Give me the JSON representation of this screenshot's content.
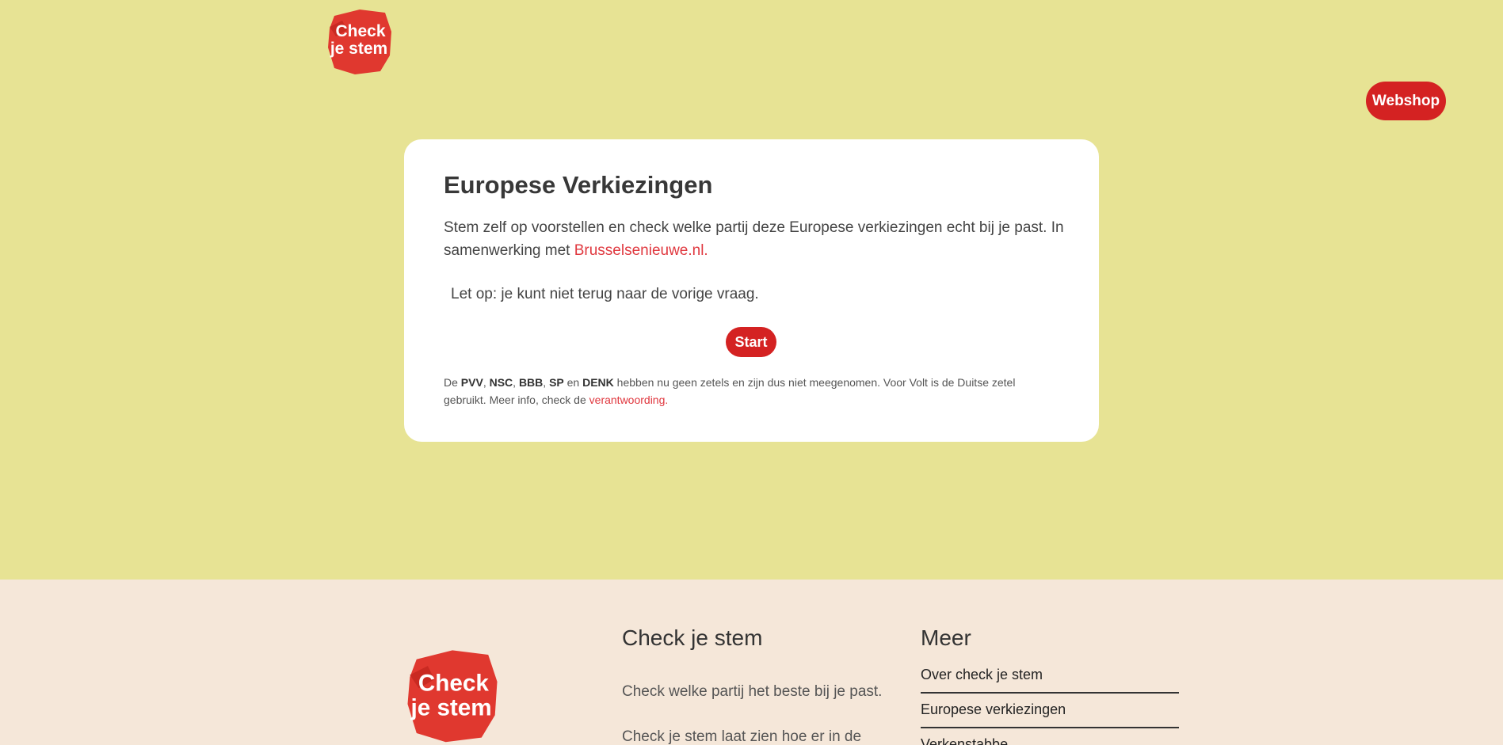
{
  "header": {
    "logo_text": "Check je stem",
    "webshop_label": "Webshop"
  },
  "card": {
    "title": "Europese Verkiezingen",
    "intro_text": "Stem zelf op voorstellen en check welke partij deze Europese verkiezingen echt bij je past. In samenwerking met ",
    "partner_link": "Brusselsenieuwe.nl.",
    "warning": "Let op: je kunt niet terug naar de vorige vraag.",
    "start_label": "Start",
    "note": {
      "prefix": "De ",
      "party1": "PVV",
      "sep1": ", ",
      "party2": "NSC",
      "sep2": ", ",
      "party3": "BBB",
      "sep3": ", ",
      "party4": "SP",
      "sep4": " en ",
      "party5": "DENK",
      "body": " hebben nu geen zetels en zijn dus niet meegenomen. Voor Volt is de Duitse zetel gebruikt. Meer info, check de ",
      "link": "verantwoording."
    }
  },
  "footer": {
    "logo_text": "Check je stem",
    "col1_title": "Check je stem",
    "col1_line1": "Check welke partij het beste bij je past.",
    "col1_line2": "Check je stem laat zien hoe er in de",
    "col2_title": "Meer",
    "links": [
      "Over check je stem",
      "Europese verkiezingen",
      "Verkenstabbe"
    ]
  },
  "colors": {
    "background": "#e7e394",
    "footer_background": "#f5e7d9",
    "accent_red": "#d42222",
    "link_red": "#e0383f"
  }
}
